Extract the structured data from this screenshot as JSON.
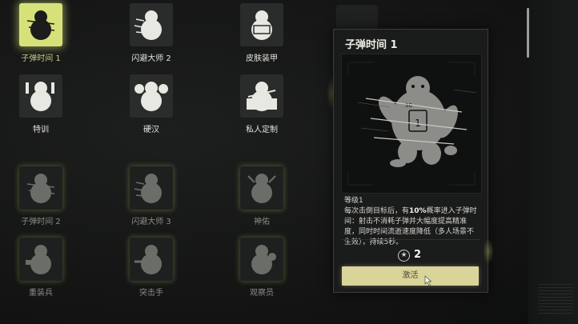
{
  "perks": [
    {
      "id": "bullet-time-1",
      "label": "子弹时间 1",
      "state": "selected",
      "icon": "bullet-time-icon"
    },
    {
      "id": "dodge-master-2",
      "label": "闪避大师 2",
      "state": "available",
      "icon": "dodge-master-icon"
    },
    {
      "id": "skin-armor",
      "label": "皮肤装甲",
      "state": "available",
      "icon": "skin-armor-icon"
    },
    {
      "id": "special-training",
      "label": "特训",
      "state": "available",
      "icon": "special-training-icon"
    },
    {
      "id": "tough-guy",
      "label": "硬汉",
      "state": "available",
      "icon": "tough-guy-icon"
    },
    {
      "id": "personal-custom",
      "label": "私人定制",
      "state": "available",
      "icon": "personal-custom-icon"
    },
    {
      "id": "bullet-time-2",
      "label": "子弹时间 2",
      "state": "locked",
      "icon": "bullet-time-icon"
    },
    {
      "id": "dodge-master-3",
      "label": "闪避大师 3",
      "state": "locked",
      "icon": "dodge-master-icon"
    },
    {
      "id": "divine-blessing",
      "label": "神佑",
      "state": "locked",
      "icon": "divine-blessing-icon"
    },
    {
      "id": "heavy-soldier",
      "label": "重装兵",
      "state": "locked",
      "icon": "heavy-soldier-icon"
    },
    {
      "id": "assaulter",
      "label": "突击手",
      "state": "locked",
      "icon": "assaulter-icon"
    },
    {
      "id": "observer",
      "label": "观察员",
      "state": "locked",
      "icon": "observer-icon"
    }
  ],
  "detail": {
    "title": "子弹时间 1",
    "level": "等级1",
    "desc_pre": "每次击倒目标后，有",
    "desc_pct": "10%",
    "desc_post": "概率进入子弹时间：射击不消耗子弹并大幅度提高精准度，同时时间流逝速度降低（多人场景不生效），持续5秒。",
    "cost": "2",
    "cost_icon": "star-coin-icon",
    "activate_label": "激活",
    "image_icon": "bullet-time-illustration"
  },
  "colors": {
    "accent": "#d7e17a",
    "button": "#d9d499",
    "background": "#141515"
  }
}
